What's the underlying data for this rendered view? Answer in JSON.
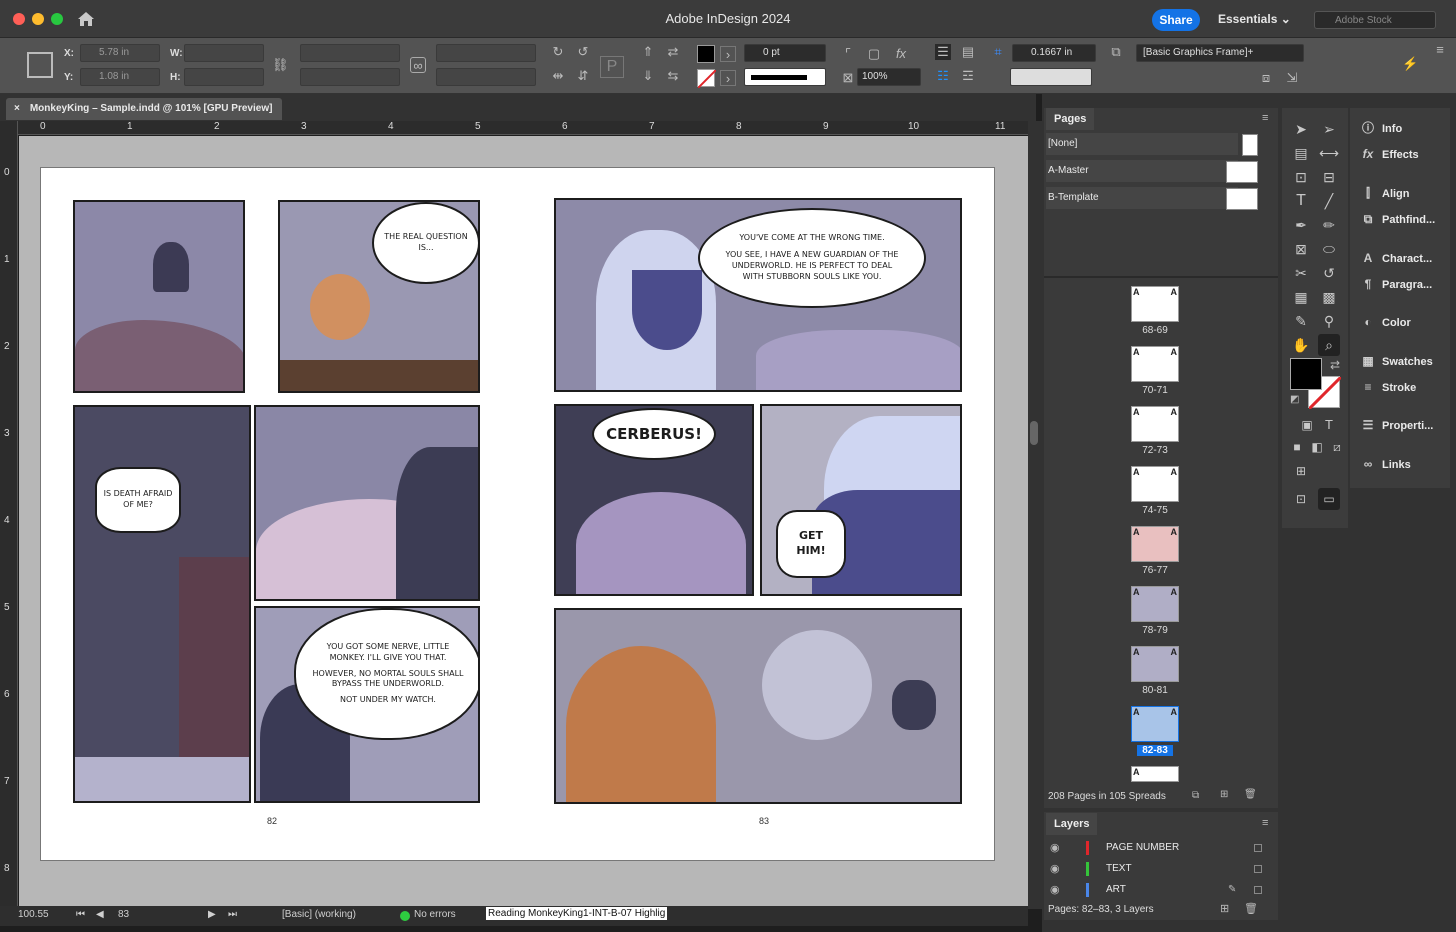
{
  "window": {
    "title": "Adobe InDesign 2024",
    "share_label": "Share",
    "workspace_label": "Essentials",
    "stock_placeholder": "Adobe Stock"
  },
  "control_bar": {
    "x_label": "X:",
    "y_label": "Y:",
    "w_label": "W:",
    "h_label": "H:",
    "x_value": "5.78 in",
    "y_value": "1.08 in",
    "stroke_weight": "0 pt",
    "scale": "100%",
    "gap": "0.1667 in",
    "object_style": "[Basic Graphics Frame]+"
  },
  "document_tab": {
    "close_glyph": "×",
    "label": "MonkeyKing – Sample.indd @ 101% [GPU Preview]"
  },
  "rulers": {
    "horizontal": [
      "0",
      "1",
      "2",
      "3",
      "4",
      "5",
      "6",
      "7",
      "8",
      "9",
      "10",
      "11"
    ],
    "vertical": [
      "0",
      "1",
      "2",
      "3",
      "4",
      "5",
      "6",
      "7",
      "8"
    ]
  },
  "comic": {
    "left_page_number": "82",
    "right_page_number": "83",
    "bubble_real_question": "THE REAL QUESTION IS...",
    "bubble_death": "IS DEATH AFRAID OF ME?",
    "bubble_nerve": "YOU GOT SOME NERVE, LITTLE MONKEY. I'LL GIVE YOU THAT.",
    "bubble_mortal": "HOWEVER, NO MORTAL SOULS SHALL BYPASS THE UNDERWORLD.",
    "bubble_watch": "NOT UNDER MY WATCH.",
    "bubble_wrong_time": "YOU'VE COME AT THE WRONG TIME.",
    "bubble_guardian": "YOU SEE, I HAVE A NEW GUARDIAN OF THE UNDERWORLD. HE IS PERFECT TO DEAL WITH STUBBORN SOULS LIKE YOU.",
    "bubble_cerberus": "CERBERUS!",
    "bubble_get_him": "GET HIM!"
  },
  "status_bar": {
    "zoom": "100.55",
    "page": "83",
    "preflight_profile": "[Basic] (working)",
    "errors": "No errors",
    "message": "Reading MonkeyKing1-INT-B-07 Highlig"
  },
  "pages_panel": {
    "title": "Pages",
    "masters": [
      "[None]",
      "A-Master",
      "B-Template"
    ],
    "spreads": [
      "68-69",
      "70-71",
      "72-73",
      "74-75",
      "76-77",
      "78-79",
      "80-81",
      "82-83"
    ],
    "selected_spread": "82-83",
    "master_prefix": "A",
    "footer": "208 Pages in 105 Spreads"
  },
  "layers_panel": {
    "title": "Layers",
    "layers": [
      {
        "name": "PAGE NUMBER",
        "color": "#e0262b"
      },
      {
        "name": "TEXT",
        "color": "#35c43a"
      },
      {
        "name": "ART",
        "color": "#4a86e8"
      }
    ],
    "footer": "Pages: 82–83, 3 Layers"
  },
  "side_panels": [
    "Info",
    "Effects",
    "Align",
    "Pathfind...",
    "Charact...",
    "Paragra...",
    "Color",
    "Swatches",
    "Stroke",
    "Properti...",
    "Links"
  ],
  "colors": {
    "accent": "#1473e6",
    "selection": "#1473e6"
  }
}
